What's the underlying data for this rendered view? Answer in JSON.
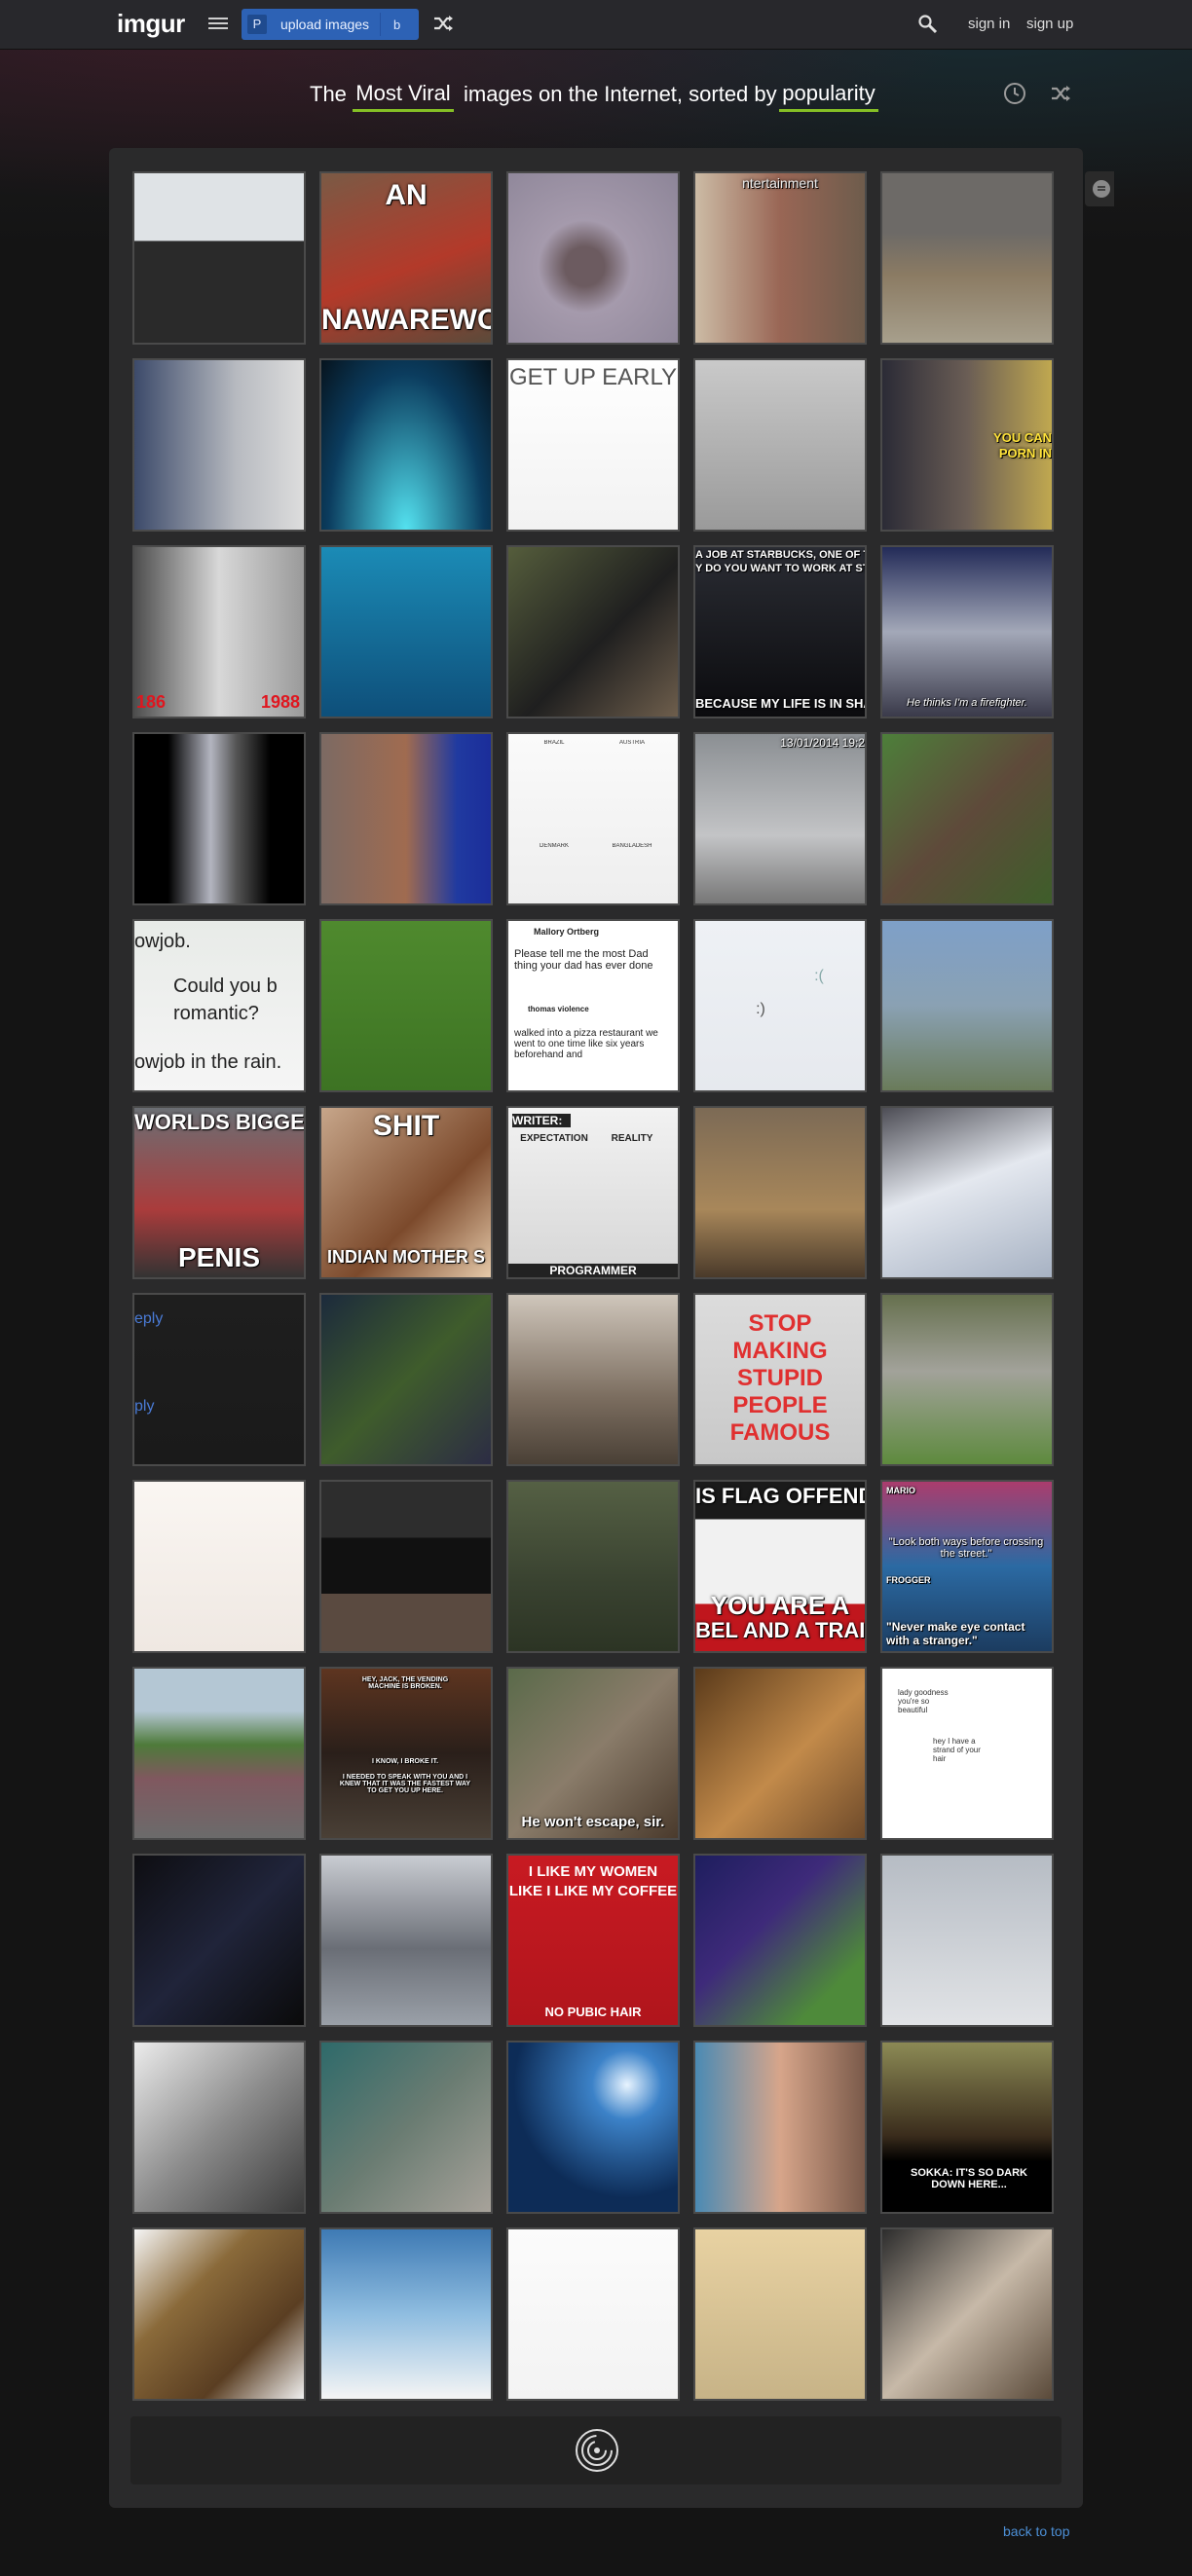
{
  "nav": {
    "logo": "imgur",
    "upload_badge": "P",
    "upload_label": "upload images",
    "upload_shortcut": "b",
    "sign_in": "sign in",
    "sign_up": "sign up"
  },
  "headline": {
    "prefix": "The",
    "section": "Most Viral",
    "middle": "images on the Internet, sorted by",
    "sort": "popularity"
  },
  "footer": {
    "back_to_top": "back to top"
  },
  "colors": {
    "accent_underline": "#85bf25",
    "upload_blue": "#2d62b5",
    "link_blue": "#4c8fd6"
  },
  "tiles": [
    {
      "name": "state-police-patches",
      "texts": []
    },
    {
      "name": "wolf-meme",
      "texts": [
        "AN",
        "NAWAREWOI"
      ]
    },
    {
      "name": "sea-otter-underwater",
      "texts": []
    },
    {
      "name": "entertainment-bowling",
      "texts": [
        "ntertainment"
      ]
    },
    {
      "name": "hunter-field",
      "texts": []
    },
    {
      "name": "cat-computer",
      "texts": []
    },
    {
      "name": "lightsabers",
      "texts": []
    },
    {
      "name": "get-up-early-comic",
      "texts": [
        "GET UP EARLY"
      ]
    },
    {
      "name": "woman-suitcase",
      "texts": []
    },
    {
      "name": "neil-tyson-meme",
      "texts": [
        "YOU CAN",
        "PORN IN"
      ]
    },
    {
      "name": "father-son-photo",
      "texts": [
        "186",
        "1988"
      ]
    },
    {
      "name": "diver-eel",
      "texts": []
    },
    {
      "name": "soldier-camera",
      "texts": []
    },
    {
      "name": "starbucks-meme",
      "texts": [
        "A JOB AT STARBUCKS, ONE OF THE QUE",
        "Y DO YOU WANT TO WORK AT STARBUC",
        "BECAUSE MY LIFE IS IN SHAME"
      ]
    },
    {
      "name": "chris-pratt",
      "texts": [
        "He thinks I'm a firefighter."
      ]
    },
    {
      "name": "concert-video",
      "texts": []
    },
    {
      "name": "satellite-city",
      "texts": []
    },
    {
      "name": "flags-comparison",
      "texts": [
        "BRAZIL",
        "AUSTRIA",
        "DENMARK",
        "BANGLADESH"
      ]
    },
    {
      "name": "street-timestamp",
      "texts": [
        "13/01/2014 19:2"
      ]
    },
    {
      "name": "husky-dogs",
      "texts": []
    },
    {
      "name": "text-message",
      "texts": [
        "owjob.",
        "Could you b",
        "romantic?",
        "owjob in the rain."
      ]
    },
    {
      "name": "grass-field",
      "texts": []
    },
    {
      "name": "tweet-dad-thing",
      "texts": [
        "Mallory Ortberg",
        "Please tell me the most Dad thing your dad has ever done",
        "thomas violence",
        "walked into a pizza restaurant we went to one time like six years beforehand and"
      ]
    },
    {
      "name": "phone-screen",
      "texts": [
        ":(",
        ":)"
      ]
    },
    {
      "name": "stone-arch",
      "texts": []
    },
    {
      "name": "worlds-biggest-meme",
      "texts": [
        "WORLDS BIGGEST",
        "PENIS"
      ]
    },
    {
      "name": "indian-mother-meme",
      "texts": [
        "SHIT",
        "INDIAN MOTHER S"
      ]
    },
    {
      "name": "writer-comic",
      "texts": [
        "WRITER:",
        "EXPECTATION",
        "REALITY",
        "PROGRAMMER"
      ]
    },
    {
      "name": "picnic-table",
      "texts": []
    },
    {
      "name": "frozen-elsa",
      "texts": []
    },
    {
      "name": "reply-screenshot",
      "texts": [
        "eply",
        "ply"
      ]
    },
    {
      "name": "game-screenshot",
      "texts": []
    },
    {
      "name": "lego-ship",
      "texts": []
    },
    {
      "name": "stop-stupid-people",
      "texts": [
        "STOP",
        "MAKING",
        "STUPID",
        "PEOPLE",
        "FAMOUS"
      ]
    },
    {
      "name": "sidewalk-kids",
      "texts": []
    },
    {
      "name": "sailboat-comic",
      "texts": []
    },
    {
      "name": "tv-show-scenes",
      "texts": []
    },
    {
      "name": "soldiers-movie",
      "texts": []
    },
    {
      "name": "flag-meme",
      "texts": [
        "IS FLAG OFFENDS",
        "YOU ARE A",
        "BEL AND A TRAIT"
      ]
    },
    {
      "name": "mario-frogger",
      "texts": [
        "MARIO",
        "\"Look both ways before crossing the street.\"",
        "FROGGER",
        "\"Never make eye contact with a stranger.\""
      ]
    },
    {
      "name": "parade-street",
      "texts": []
    },
    {
      "name": "office-vending",
      "texts": [
        "HEY, JACK, THE VENDING MACHINE IS BROKEN.",
        "I KNOW, I BROKE IT.",
        "I NEEDED TO SPEAK WITH YOU AND I KNEW THAT IT WAS THE FASTEST WAY TO GET YOU UP HERE."
      ]
    },
    {
      "name": "simpsons-monitors",
      "texts": [
        "He won't escape, sir."
      ]
    },
    {
      "name": "tiger-cub",
      "texts": []
    },
    {
      "name": "drawn-comic",
      "texts": [
        "lady goodness you're so beautiful",
        "hey I have a strand of your hair"
      ]
    },
    {
      "name": "night-crowd",
      "texts": []
    },
    {
      "name": "alley-car",
      "texts": []
    },
    {
      "name": "coffee-meme",
      "texts": [
        "I LIKE MY WOMEN",
        "LIKE I LIKE MY COFFEE",
        "NO PUBIC HAIR"
      ]
    },
    {
      "name": "cartoon-character",
      "texts": []
    },
    {
      "name": "fight-scene",
      "texts": []
    },
    {
      "name": "sugar-glider",
      "texts": []
    },
    {
      "name": "kiwi-bird",
      "texts": []
    },
    {
      "name": "underwater-light",
      "texts": []
    },
    {
      "name": "tattoo-selfie",
      "texts": []
    },
    {
      "name": "sokka-meme",
      "texts": [
        "SOKKA: IT'S SO DARK DOWN HERE..."
      ]
    },
    {
      "name": "tree-roots",
      "texts": []
    },
    {
      "name": "sky-clouds",
      "texts": []
    },
    {
      "name": "blank-page",
      "texts": []
    },
    {
      "name": "four-panel-comic",
      "texts": []
    },
    {
      "name": "cat-dog-sleeping",
      "texts": []
    }
  ]
}
